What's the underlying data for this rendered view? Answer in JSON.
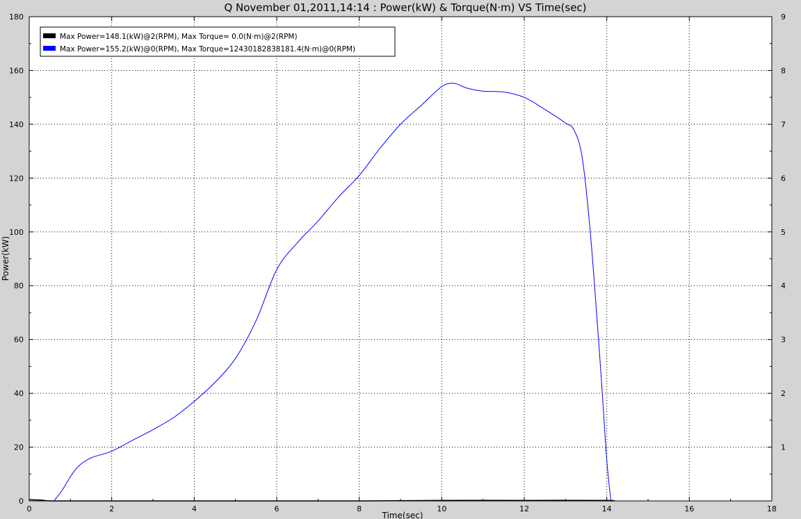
{
  "chart_data": {
    "type": "line",
    "title": "Q November 01,2011,14:14  : Power(kW) & Torque(N·m) VS Time(sec)",
    "xlabel": "Time(sec)",
    "ylabel": "Power(kW)",
    "xlim": [
      0,
      18
    ],
    "ylim": [
      0,
      180
    ],
    "x_ticks": [
      0,
      2,
      4,
      6,
      8,
      10,
      12,
      14,
      16,
      18
    ],
    "y_ticks": [
      0,
      20,
      40,
      60,
      80,
      100,
      120,
      140,
      160,
      180
    ],
    "right_axis_partial_labels": [
      "9",
      "8",
      "7",
      "6",
      "5",
      "4",
      "3",
      "2",
      "1"
    ],
    "grid": true,
    "legend_position": "top-left",
    "series": [
      {
        "name": "Max Power=148.1(kW)@2(RPM), Max Torque=  0.0(N·m)@2(RPM)",
        "color": "#000000",
        "x": [
          0,
          0.3,
          0.6,
          2,
          4,
          6,
          8,
          10,
          12,
          14,
          14.1
        ],
        "y": [
          0.5,
          0.3,
          0,
          0,
          0,
          0,
          0,
          0.2,
          0.2,
          0.2,
          0
        ]
      },
      {
        "name": "Max Power=155.2(kW)@0(RPM), Max Torque=12430182838181.4(N·m)@0(RPM)",
        "color": "#0000ff",
        "x": [
          0.6,
          0.8,
          1.0,
          1.2,
          1.5,
          2.0,
          2.5,
          3.0,
          3.5,
          4.0,
          4.5,
          5.0,
          5.5,
          6.0,
          6.5,
          7.0,
          7.5,
          8.0,
          8.5,
          9.0,
          9.5,
          10.0,
          10.3,
          10.6,
          11.0,
          11.5,
          12.0,
          12.5,
          13.0,
          13.2,
          13.4,
          13.6,
          13.8,
          13.9,
          14.0,
          14.1
        ],
        "y": [
          0,
          4,
          9,
          13,
          16,
          18.5,
          22.5,
          26.5,
          31,
          37,
          44,
          53,
          67,
          86,
          96,
          104,
          113,
          121,
          131,
          140,
          147,
          154,
          155.2,
          153.5,
          152.3,
          152,
          150,
          145.5,
          140.5,
          138,
          128,
          100,
          60,
          38,
          15,
          0
        ]
      }
    ]
  }
}
